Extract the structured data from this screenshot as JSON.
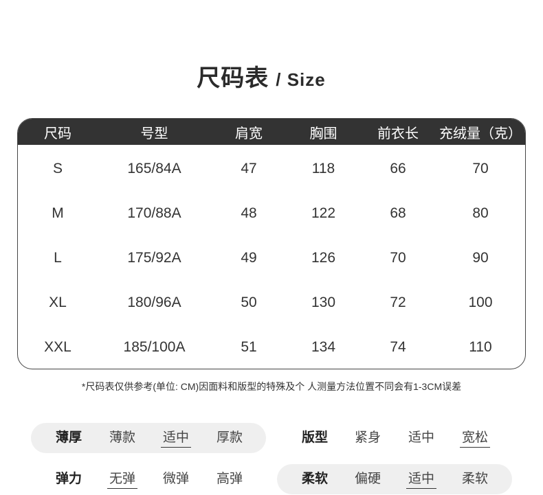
{
  "title": {
    "cn": "尺码表",
    "en": "/ Size"
  },
  "table": {
    "headers": [
      "尺码",
      "号型",
      "肩宽",
      "胸围",
      "前衣长",
      "充绒量（克）"
    ],
    "rows": [
      [
        "S",
        "165/84A",
        "47",
        "118",
        "66",
        "70"
      ],
      [
        "M",
        "170/88A",
        "48",
        "122",
        "68",
        "80"
      ],
      [
        "L",
        "175/92A",
        "49",
        "126",
        "70",
        "90"
      ],
      [
        "XL",
        "180/96A",
        "50",
        "130",
        "72",
        "100"
      ],
      [
        "XXL",
        "185/100A",
        "51",
        "134",
        "74",
        "110"
      ]
    ]
  },
  "note": "*尺码表仅供参考(单位: CM)因面料和版型的特殊及个 人测量方法位置不同会有1-3CM误差",
  "attributes": {
    "thickness": {
      "label": "薄厚",
      "options": [
        "薄款",
        "适中",
        "厚款"
      ],
      "selected": "适中"
    },
    "fit": {
      "label": "版型",
      "options": [
        "紧身",
        "适中",
        "宽松"
      ],
      "selected": "宽松"
    },
    "elasticity": {
      "label": "弹力",
      "options": [
        "无弹",
        "微弹",
        "高弹"
      ],
      "selected": "无弹"
    },
    "softness": {
      "label": "柔软",
      "options": [
        "偏硬",
        "适中",
        "柔软"
      ],
      "selected": "适中"
    }
  },
  "colors": {
    "header_bg": "#333333",
    "pill_bg": "#efefef",
    "text": "#333333"
  }
}
